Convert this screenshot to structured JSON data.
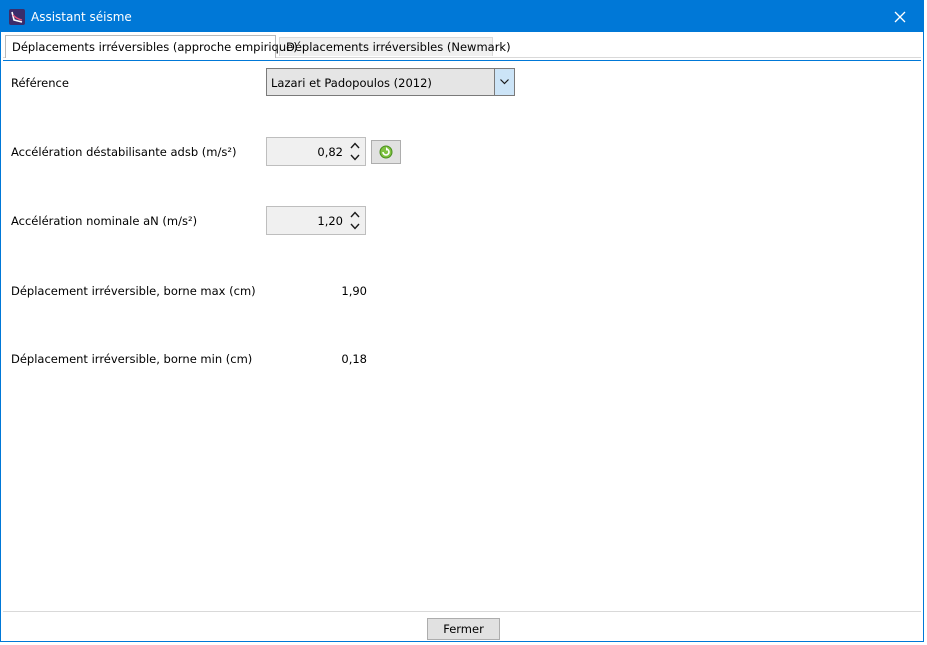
{
  "window": {
    "title": "Assistant séisme",
    "accent_color": "#0078d7"
  },
  "tabs": [
    {
      "label": "Déplacements irréversibles (approche empirique)",
      "active": true
    },
    {
      "label": "Déplacements irréversibles (Newmark)",
      "active": false
    }
  ],
  "form": {
    "reference_label": "Référence",
    "reference_value": "Lazari et Padopoulos (2012)",
    "adsb_label": "Accélération déstabilisante adsb (m/s²)",
    "adsb_value": "0,82",
    "an_label": "Accélération nominale aN (m/s²)",
    "an_value": "1,20",
    "dmax_label": "Déplacement irréversible, borne max (cm)",
    "dmax_value": "1,90",
    "dmin_label": "Déplacement irréversible, borne min (cm)",
    "dmin_value": "0,18"
  },
  "footer": {
    "close_label": "Fermer"
  },
  "icons": {
    "app": "app-icon",
    "close": "close-icon",
    "dropdown": "chevron-down-icon",
    "spin_up": "chevron-up-icon",
    "spin_down": "chevron-down-icon",
    "refresh": "refresh-icon"
  }
}
